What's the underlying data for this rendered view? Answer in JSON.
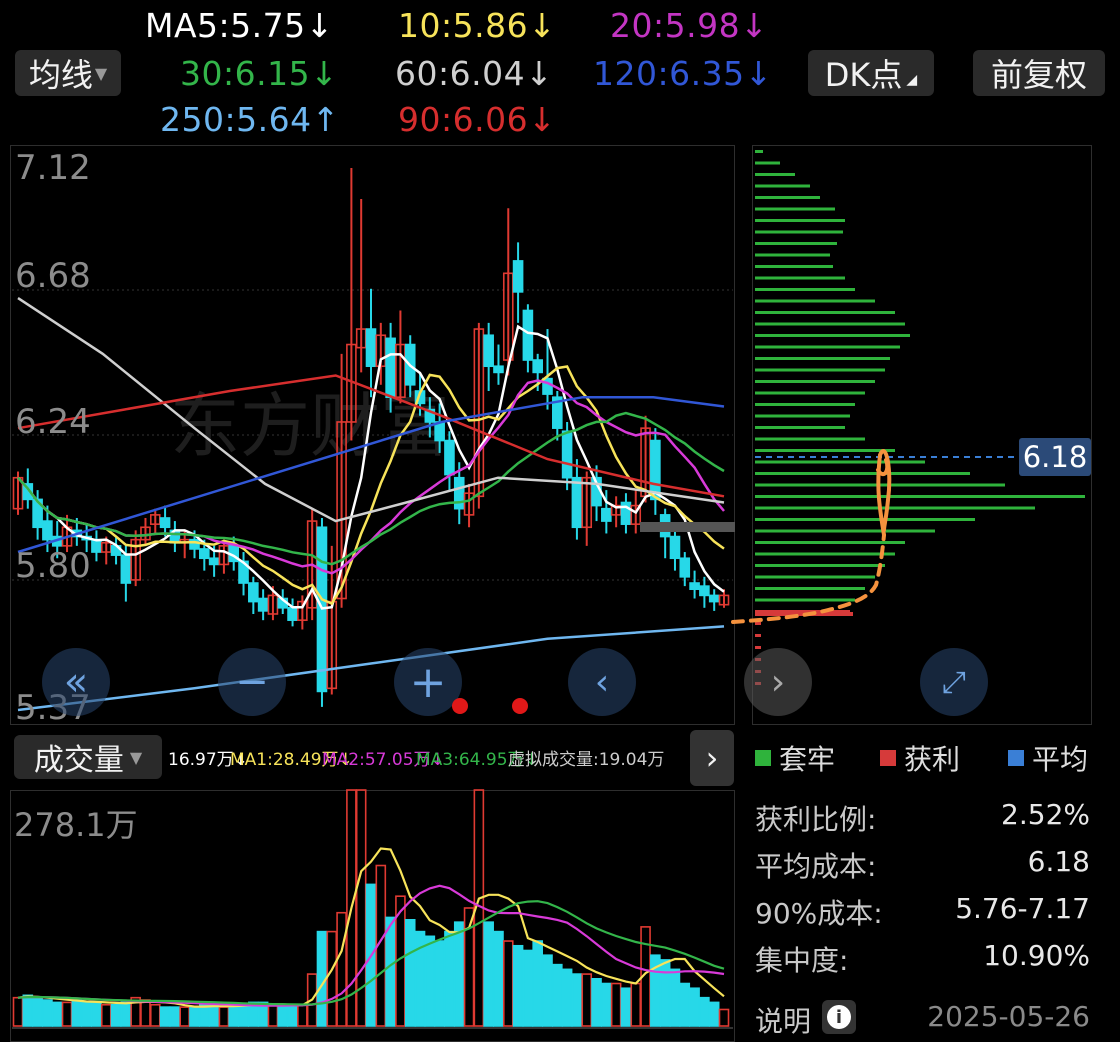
{
  "colors": {
    "up": "#e03a32",
    "down": "#27d8e8",
    "ma5": "#ffffff",
    "ma10": "#f7e35a",
    "ma20": "#d83ad8",
    "ma30": "#33b54a",
    "ma60": "#cfcfcf",
    "ma90": "#d62e2e",
    "ma120": "#3157d6",
    "ma250": "#6fb7f0",
    "profile_green": "#2fb33c",
    "profile_red": "#d63a3a",
    "profile_avg": "#3a7fd6",
    "annotation": "#f5923e"
  },
  "toolbar": {
    "ma_button": "均线",
    "dk_button": "DK点",
    "fq_button": "前复权"
  },
  "ma_labels": {
    "ma5": "MA5:5.75↓",
    "ma10": "10:5.86↓",
    "ma20": "20:5.98↓",
    "ma30": "30:6.15↓",
    "ma60": "60:6.04↓",
    "ma120": "120:6.35↓",
    "ma250": "250:5.64↑",
    "ma90": "90:6.06↓"
  },
  "price_axis": {
    "p1": "7.12",
    "p2": "6.68",
    "p3": "6.24",
    "p4": "5.80",
    "p5": "5.37"
  },
  "watermark": "东方财富",
  "cost_marker": "6.18",
  "volume": {
    "selector": "成交量",
    "vol": "16.97万↓",
    "ma1": "MA1:28.49万↓",
    "ma2": "MA2:57.05万↓",
    "ma3": "MA3:64.95万↓",
    "virtual": "虚拟成交量:19.04万",
    "max_label": "278.1万"
  },
  "legend": {
    "trapped": "套牢",
    "profit": "获利",
    "average": "平均"
  },
  "stats": {
    "profit_ratio_label": "获利比例:",
    "profit_ratio": "2.52%",
    "avg_cost_label": "平均成本:",
    "avg_cost": "6.18",
    "cost90_label": "90%成本:",
    "cost90": "5.76-7.17",
    "concentration_label": "集中度:",
    "concentration": "10.90%",
    "note_label": "说明",
    "date": "2025-05-26"
  },
  "chart_data": {
    "type": "candlestick",
    "y_range": [
      5.37,
      7.12
    ],
    "candles": [
      [
        6.02,
        6.12,
        6.14,
        6.0
      ],
      [
        6.1,
        6.05,
        6.15,
        6.02
      ],
      [
        6.05,
        5.96,
        6.08,
        5.92
      ],
      [
        5.98,
        5.92,
        6.03,
        5.88
      ],
      [
        5.93,
        5.9,
        5.98,
        5.86
      ],
      [
        5.9,
        5.96,
        6.0,
        5.88
      ],
      [
        5.95,
        5.93,
        5.99,
        5.9
      ],
      [
        5.93,
        5.92,
        5.97,
        5.88
      ],
      [
        5.92,
        5.88,
        5.95,
        5.85
      ],
      [
        5.88,
        5.91,
        5.93,
        5.84
      ],
      [
        5.9,
        5.87,
        5.93,
        5.84
      ],
      [
        5.87,
        5.78,
        5.9,
        5.72
      ],
      [
        5.79,
        5.92,
        5.95,
        5.77
      ],
      [
        5.92,
        5.96,
        5.99,
        5.9
      ],
      [
        5.97,
        6.0,
        6.02,
        5.94
      ],
      [
        5.99,
        5.96,
        6.03,
        5.93
      ],
      [
        5.95,
        5.91,
        5.98,
        5.88
      ],
      [
        5.91,
        5.92,
        5.95,
        5.86
      ],
      [
        5.92,
        5.89,
        5.95,
        5.86
      ],
      [
        5.89,
        5.86,
        5.92,
        5.82
      ],
      [
        5.86,
        5.84,
        5.9,
        5.8
      ],
      [
        5.84,
        5.9,
        5.92,
        5.81
      ],
      [
        5.9,
        5.85,
        5.93,
        5.82
      ],
      [
        5.85,
        5.78,
        5.88,
        5.74
      ],
      [
        5.78,
        5.72,
        5.8,
        5.68
      ],
      [
        5.73,
        5.69,
        5.76,
        5.66
      ],
      [
        5.68,
        5.74,
        5.77,
        5.66
      ],
      [
        5.73,
        5.7,
        5.76,
        5.68
      ],
      [
        5.7,
        5.66,
        5.73,
        5.64
      ],
      [
        5.66,
        5.72,
        5.74,
        5.63
      ],
      [
        5.7,
        5.98,
        6.02,
        5.66
      ],
      [
        5.96,
        5.43,
        5.99,
        5.38
      ],
      [
        5.44,
        5.72,
        5.9,
        5.42
      ],
      [
        5.73,
        6.3,
        6.52,
        5.7
      ],
      [
        6.3,
        6.55,
        7.12,
        6.24
      ],
      [
        6.54,
        6.6,
        7.02,
        6.46
      ],
      [
        6.6,
        6.48,
        6.73,
        6.38
      ],
      [
        6.48,
        6.58,
        6.62,
        6.42
      ],
      [
        6.57,
        6.38,
        6.62,
        6.33
      ],
      [
        6.38,
        6.55,
        6.66,
        6.36
      ],
      [
        6.55,
        6.42,
        6.58,
        6.38
      ],
      [
        6.4,
        6.36,
        6.46,
        6.32
      ],
      [
        6.34,
        6.3,
        6.38,
        6.25
      ],
      [
        6.3,
        6.24,
        6.36,
        6.2
      ],
      [
        6.24,
        6.13,
        6.27,
        6.08
      ],
      [
        6.12,
        6.02,
        6.17,
        5.97
      ],
      [
        6.0,
        6.07,
        6.1,
        5.96
      ],
      [
        6.06,
        6.6,
        6.62,
        6.02
      ],
      [
        6.58,
        6.48,
        6.62,
        6.4
      ],
      [
        6.48,
        6.46,
        6.55,
        6.42
      ],
      [
        6.5,
        6.78,
        6.99,
        6.45
      ],
      [
        6.82,
        6.72,
        6.88,
        6.62
      ],
      [
        6.66,
        6.5,
        6.68,
        6.46
      ],
      [
        6.5,
        6.46,
        6.52,
        6.4
      ],
      [
        6.44,
        6.39,
        6.6,
        6.34
      ],
      [
        6.38,
        6.28,
        6.4,
        6.24
      ],
      [
        6.27,
        6.12,
        6.3,
        6.08
      ],
      [
        6.12,
        5.96,
        6.18,
        5.92
      ],
      [
        5.96,
        6.12,
        6.14,
        5.9
      ],
      [
        6.12,
        6.03,
        6.16,
        5.98
      ],
      [
        6.02,
        5.98,
        6.08,
        5.94
      ],
      [
        6.0,
        6.03,
        6.06,
        5.96
      ],
      [
        6.04,
        5.97,
        6.07,
        5.94
      ],
      [
        5.97,
        6.03,
        6.08,
        5.94
      ],
      [
        6.06,
        6.28,
        6.32,
        6.04
      ],
      [
        6.24,
        6.05,
        6.28,
        6.0
      ],
      [
        6.0,
        5.93,
        6.02,
        5.86
      ],
      [
        5.93,
        5.86,
        5.95,
        5.82
      ],
      [
        5.86,
        5.8,
        5.88,
        5.77
      ],
      [
        5.78,
        5.76,
        5.82,
        5.73
      ],
      [
        5.77,
        5.74,
        5.8,
        5.7
      ],
      [
        5.74,
        5.72,
        5.76,
        5.69
      ],
      [
        5.71,
        5.74,
        5.76,
        5.7
      ]
    ]
  }
}
